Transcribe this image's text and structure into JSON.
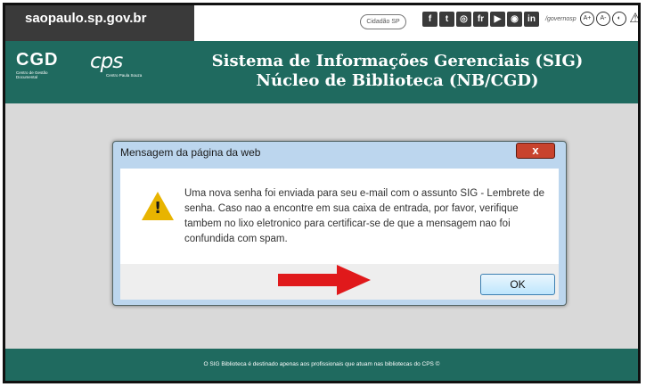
{
  "govbar": {
    "site": "saopaulo.sp.gov.br",
    "cidadao": "Cidadão SP",
    "social_icons": [
      {
        "name": "facebook-icon",
        "glyph": "f"
      },
      {
        "name": "twitter-icon",
        "glyph": "t"
      },
      {
        "name": "instagram-icon",
        "glyph": "◎"
      },
      {
        "name": "flickr-icon",
        "glyph": "fr"
      },
      {
        "name": "youtube-icon",
        "glyph": "▶"
      },
      {
        "name": "camera-icon",
        "glyph": "◉"
      },
      {
        "name": "linkedin-icon",
        "glyph": "in"
      }
    ],
    "handle": "/governosp",
    "a11y": {
      "increase_font": "A+",
      "decrease_font": "A-",
      "contrast": "◐",
      "warning": "⚠"
    }
  },
  "header": {
    "logo_cgd": "CGD",
    "logo_cgd_subtitle": "Centro de Gestão Documental",
    "logo_cps": "cps",
    "logo_cps_subtitle": "Centro Paula Souza",
    "title_line1": "Sistema de Informações Gerenciais (SIG)",
    "title_line2": "Núcleo de Biblioteca (NB/CGD)"
  },
  "dialog": {
    "title": "Mensagem da página da web",
    "close_label": "x",
    "warning_glyph": "!",
    "message": "Uma nova senha foi enviada para seu e-mail com o assunto SIG - Lembrete de senha. Caso nao a encontre em sua caixa de entrada, por favor, verifique tambem no lixo eletronico para certificar-se de que a mensagem nao foi confundida com spam.",
    "ok_label": "OK"
  },
  "arrow_color": "#e0191b",
  "footer": {
    "text": "O SIG Biblioteca é destinado apenas aos profissionais que atuam nas bibliotecas do CPS ©"
  }
}
